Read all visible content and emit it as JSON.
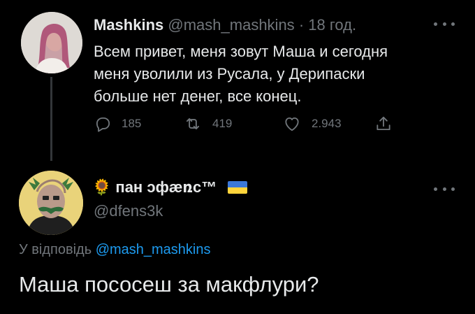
{
  "parent_tweet": {
    "display_name": "Mashkins",
    "handle": "@mash_mashkins",
    "separator": "·",
    "timestamp": "18 год.",
    "text": "Всем привет, меня зовут Маша и сегодня\nменя уволили из Русала, у Дерипаски\nбольше нет денег, все конец.",
    "actions": {
      "reply_icon": "reply-icon",
      "reply_count": "185",
      "retweet_icon": "retweet-icon",
      "retweet_count": "419",
      "like_icon": "heart-icon",
      "like_count": "2.943",
      "share_icon": "share-icon"
    }
  },
  "reply_tweet": {
    "emoji": "🌻",
    "display_name": "пан ɔфæռc™",
    "flag": "ukraine-flag",
    "handle": "@dfens3k",
    "replying_to_label": "У відповідь",
    "replying_to_handle": "@mash_mashkins",
    "text": "Маша пососеш за макфлури?"
  },
  "colors": {
    "background": "#000000",
    "primary_text": "#e7e9ea",
    "secondary_text": "#71767b",
    "link": "#1d9bf0",
    "thread_line": "#333639"
  }
}
